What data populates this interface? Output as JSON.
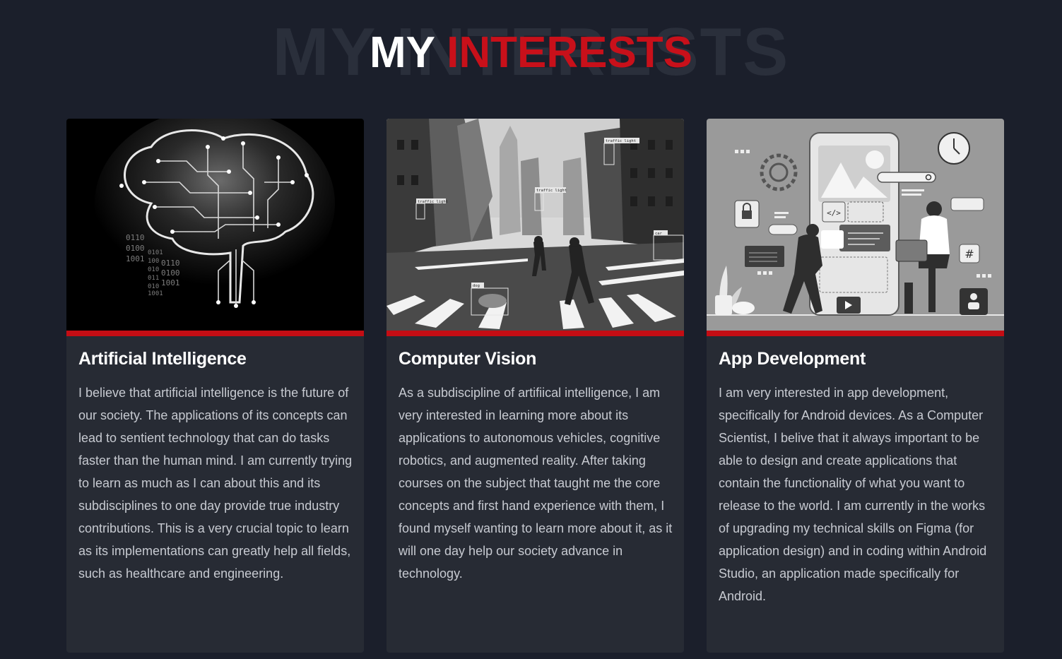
{
  "header": {
    "background_text": "MY INTERESTS",
    "word1": "MY",
    "word2": "INTERESTS",
    "accent_color": "#c8101a"
  },
  "cards": [
    {
      "image_icon": "circuit-brain-icon",
      "binary_lines": [
        "0110",
        "0100",
        "1001",
        "0101",
        "100",
        "0110",
        "010",
        "0100",
        "011",
        "1001",
        "010",
        "1001"
      ],
      "title": "Artificial Intelligence",
      "body": "I believe that artificial intelligence is the future of our society. The applications of its concepts can lead to sentient technology that can do tasks faster than the human mind. I am currently trying to learn as much as I can about this and its subdisciplines to one day provide true industry contributions. This is a very crucial topic to learn as its implementations can greatly help all fields, such as healthcare and engineering."
    },
    {
      "image_icon": "street-object-detection-icon",
      "detection_labels": [
        "traffic light",
        "traffic light",
        "traffic light",
        "car",
        "dog"
      ],
      "title": "Computer Vision",
      "body": "As a subdiscipline of artifiical intelligence, I am very interested in learning more about its applications to autonomous vehicles, cognitive robotics, and augmented reality. After taking courses on the subject that taught me the core concepts and first hand experience with them, I found myself wanting to learn more about it, as it will one day help our society advance in technology."
    },
    {
      "image_icon": "app-development-illustration-icon",
      "illustration_symbols": [
        "</>",
        "#"
      ],
      "title": "App Development",
      "body": "I am very interested in app development, specifically for Android devices. As a Computer Scientist, I belive that it always important to be able to design and create applications that contain the functionality of what you want to release to the world. I am currently in the works of upgrading my technical skills on Figma (for application design) and in coding within Android Studio, an application made specifically for Android."
    }
  ]
}
